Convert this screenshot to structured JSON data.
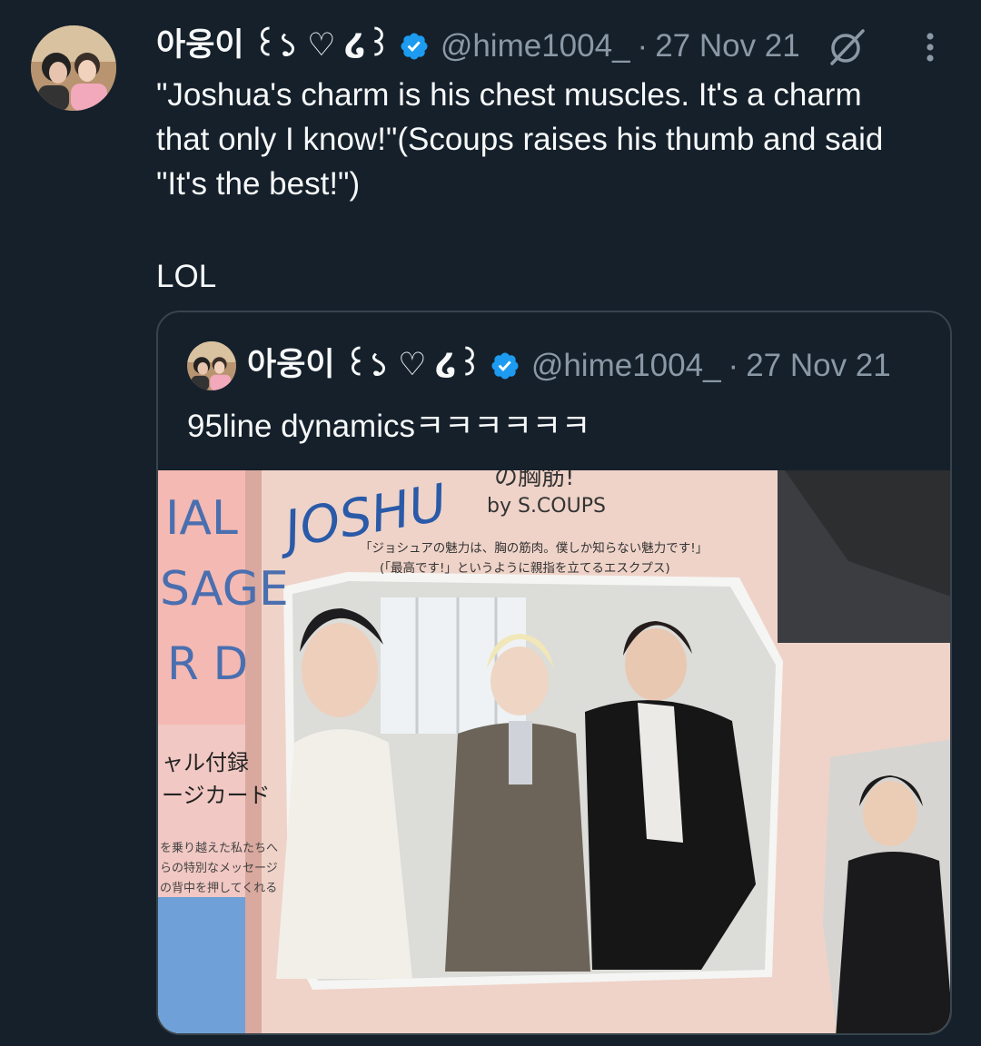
{
  "tweet": {
    "author_name": "아웅이 ꒰১ ♡ ໒꒱",
    "handle": "@hime1004_",
    "separator": "·",
    "date": "27 Nov 21",
    "text": "\"Joshua's charm is his chest muscles. It's a charm\nthat only I know!\"(Scoups raises his thumb and said\n\"It's the best!\")",
    "text_lol": "LOL"
  },
  "quote": {
    "author_name": "아웅이 ꒰১ ♡ ໒꒱",
    "handle": "@hime1004_",
    "separator": "·",
    "date": "27 Nov 21",
    "text": "95line dynamicsㅋㅋㅋㅋㅋㅋ"
  },
  "media": {
    "headline": "JOSHU",
    "headline_suffix": "の胸筋!",
    "byline": "by S.COUPS",
    "caption_line1": "「ジョシュアの魅力は、胸の筋肉。僕しか知らない魅力です!」",
    "caption_line2": "(「最高です!」というように親指を立てるエスクプス)",
    "spine_line1": "IAL",
    "spine_line2": "SAGE",
    "spine_line3": "R D",
    "spine_jp1": "ャル付録",
    "spine_jp2": "ージカード",
    "spine_small1": "を乗り越えた私たちへ",
    "spine_small2": "らの特別なメッセージ",
    "spine_small3": "の背中を押してくれる"
  },
  "icons": {
    "verified": "verified-badge-icon",
    "grok": "grok-icon",
    "more": "more-options-icon"
  },
  "colors": {
    "background": "#15202b",
    "text": "#f7f9f9",
    "muted": "#8b98a5",
    "verified": "#1d9bf0",
    "border": "#38444d"
  }
}
